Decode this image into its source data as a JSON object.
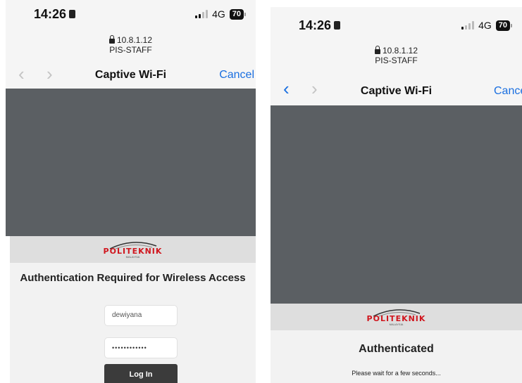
{
  "left_screen": {
    "status_bar": {
      "time": "14:26",
      "network": "4G",
      "battery": "70"
    },
    "url_bar": {
      "address": "10.8.1.12",
      "ssid": "PIS-STAFF"
    },
    "nav": {
      "back": "‹",
      "forward": "›",
      "title": "Captive Wi-Fi",
      "cancel": "Cancel"
    },
    "logo": {
      "name": "POLITEKNIK",
      "subtitle": "MALAYSIA"
    },
    "login": {
      "heading": "Authentication Required for Wireless Access",
      "username_value": "dewiyana",
      "password_value": "••••••••••••",
      "login_button": "Log In"
    }
  },
  "right_screen": {
    "status_bar": {
      "time": "14:26",
      "network": "4G",
      "battery": "70"
    },
    "url_bar": {
      "address": "10.8.1.12",
      "ssid": "PIS-STAFF"
    },
    "nav": {
      "back": "‹",
      "forward": "›",
      "title": "Captive Wi-Fi",
      "cancel": "Cancel"
    },
    "logo": {
      "name": "POLITEKNIK",
      "subtitle": "MALAYSIA"
    },
    "auth": {
      "heading": "Authenticated",
      "message": "Please wait for a few seconds..."
    }
  },
  "colors": {
    "accent": "#1a6fe0",
    "logo_red": "#d0161e",
    "overlay": "#5b5f63",
    "button": "#3b3b3b"
  },
  "icons": [
    "lock-icon",
    "signal-icon",
    "battery-icon",
    "back-chevron-icon",
    "forward-chevron-icon"
  ]
}
